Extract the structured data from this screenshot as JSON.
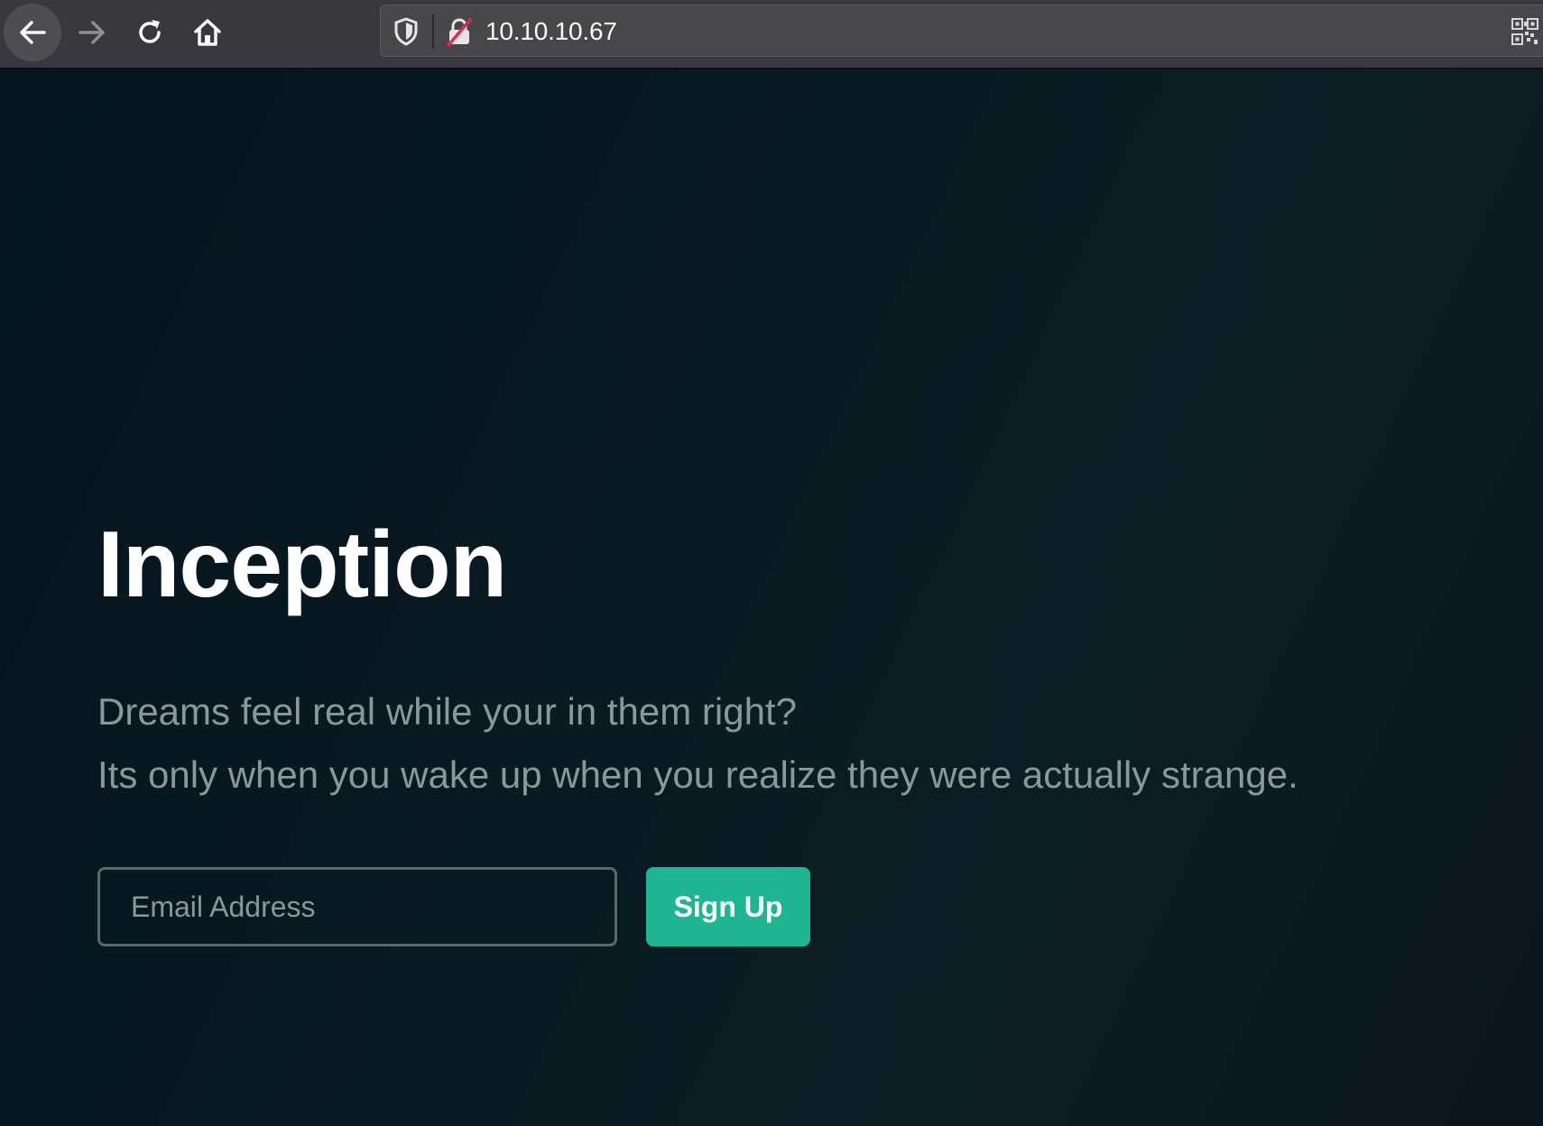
{
  "browser": {
    "url": "10.10.10.67",
    "icons": {
      "back": "back-arrow-icon",
      "forward": "forward-arrow-icon",
      "reload": "reload-icon",
      "home": "home-icon",
      "tracking": "shield-icon",
      "connection": "insecure-lock-icon",
      "qr": "qr-code-icon"
    }
  },
  "hero": {
    "title": "Inception",
    "line1": "Dreams feel real while your in them right?",
    "line2": "Its only when you wake up when you realize they were actually strange."
  },
  "signup_form": {
    "email_placeholder": "Email Address",
    "email_value": "",
    "button_label": "Sign Up"
  },
  "colors": {
    "background": "#081820",
    "accent": "#1fb592",
    "muted_text": "#8c979c"
  }
}
